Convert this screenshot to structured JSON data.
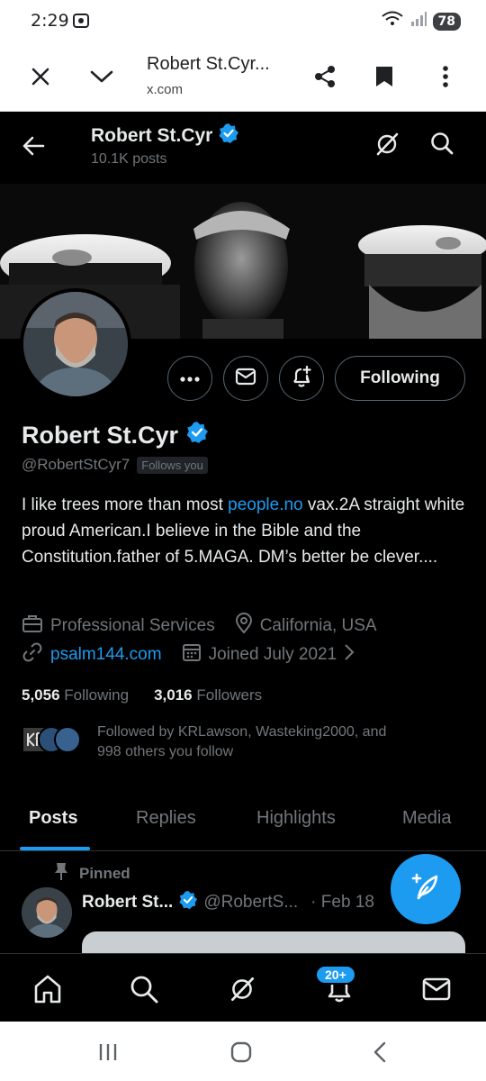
{
  "status_bar": {
    "time": "2:29",
    "battery": "78"
  },
  "browser": {
    "title": "Robert St.Cyr...",
    "url": "x.com"
  },
  "header": {
    "name": "Robert St.Cyr",
    "posts_count": "10.1K posts"
  },
  "profile": {
    "name": "Robert St.Cyr",
    "handle": "@RobertStCyr7",
    "follows_you": "Follows you",
    "following_button": "Following",
    "bio_part1": "I like trees more than most ",
    "bio_link": "people.no",
    "bio_part2": " vax.2A straight white proud American.I believe in the Bible and the Constitution.father of 5.MAGA. DM’s better be clever....",
    "category": "Professional Services",
    "location": "California, USA",
    "website": "psalm144.com",
    "joined": "Joined July 2021",
    "following_count": "5,056",
    "following_label": "Following",
    "followers_count": "3,016",
    "followers_label": "Followers",
    "followed_by_line1": "Followed by KRLawson, Wasteking2000, and",
    "followed_by_line2": "998 others you follow"
  },
  "tabs": [
    {
      "label": "Posts",
      "active": true
    },
    {
      "label": "Replies",
      "active": false
    },
    {
      "label": "Highlights",
      "active": false
    },
    {
      "label": "Media",
      "active": false
    }
  ],
  "pinned_post": {
    "pinned_label": "Pinned",
    "author": "Robert St...",
    "handle": "@RobertS...",
    "date": "· Feb 18"
  },
  "bottom_nav": {
    "notifications_badge": "20+"
  },
  "colors": {
    "accent": "#1d9bf0",
    "background": "#000000",
    "text": "#e7e9ea",
    "muted": "#71767b"
  },
  "icons": [
    "close-icon",
    "chevron-down-icon",
    "share-icon",
    "bookmark-icon",
    "more-vert-icon",
    "back-arrow-icon",
    "grok-icon",
    "search-icon",
    "more-icon",
    "mail-icon",
    "notification-plus-icon",
    "verified-icon",
    "briefcase-icon",
    "location-icon",
    "link-icon",
    "calendar-icon",
    "pin-icon",
    "compose-icon",
    "home-icon",
    "bell-icon"
  ]
}
